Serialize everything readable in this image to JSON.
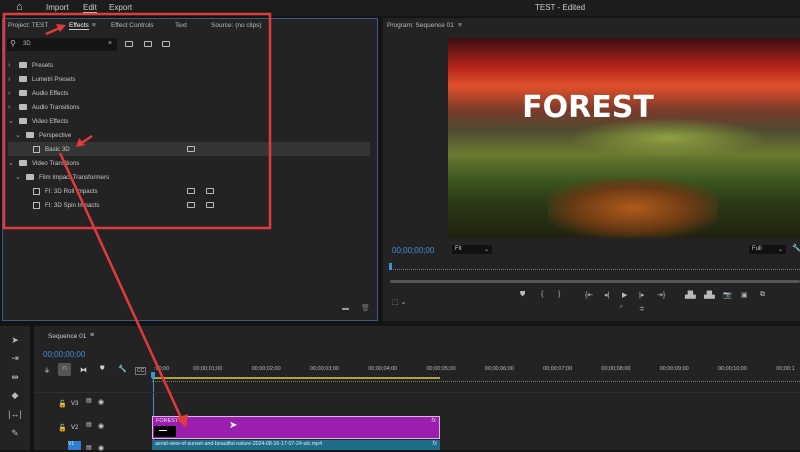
{
  "menu": {
    "import": "Import",
    "edit": "Edit",
    "export": "Export",
    "title": "TEST - Edited"
  },
  "left_panel": {
    "tabs": [
      "Project: TEST",
      "Effects",
      "Effect Controls",
      "Text",
      "Source: (no clips)"
    ],
    "search_value": "3D"
  },
  "tree": [
    {
      "label": "Presets",
      "level": 0,
      "expanded": false
    },
    {
      "label": "Lumetri Presets",
      "level": 0,
      "expanded": false
    },
    {
      "label": "Audio Effects",
      "level": 0,
      "expanded": false
    },
    {
      "label": "Audio Transitions",
      "level": 0,
      "expanded": false
    },
    {
      "label": "Video Effects",
      "level": 0,
      "expanded": true
    },
    {
      "label": "Perspective",
      "level": 1,
      "expanded": true
    },
    {
      "label": "Basic 3D",
      "level": 2,
      "selected": true
    },
    {
      "label": "Video Transitions",
      "level": 0,
      "expanded": true
    },
    {
      "label": "Film Impact Transformers",
      "level": 1,
      "expanded": true
    },
    {
      "label": "FI: 3D Roll Impacts",
      "level": 2
    },
    {
      "label": "FI: 3D Spin Impacts",
      "level": 2
    }
  ],
  "program": {
    "title": "Program: Sequence 01",
    "video_text": "FOREST",
    "timecode": "00;00;00;00",
    "fit": "Fit",
    "quality": "Full"
  },
  "timeline": {
    "title": "Sequence 01",
    "timecode": "00;00;00;00",
    "ruler": [
      ":00;00",
      "00;00;01;00",
      "00;00;02;00",
      "00;00;03;00",
      "00;00;04;00",
      "00;00;05;00",
      "00;00;06;00",
      "00;00;07;00",
      "00;00;08;00",
      "00;00;09;00",
      "00;00;10;00",
      "00;00;1"
    ],
    "tracks": [
      "V3",
      "V2",
      "V1"
    ],
    "clip_v2": "FOREST",
    "clip_v1": "aerial-view-of-sunset-and-beautiful-nature-2024-08-16-17-07-24-utc.mp4",
    "fx": "fx"
  },
  "colors": {
    "accent": "#3d8fe0",
    "annotation": "#e03b3b",
    "clip_v2": "#9b1fae",
    "clip_v1": "#1f6d88"
  }
}
